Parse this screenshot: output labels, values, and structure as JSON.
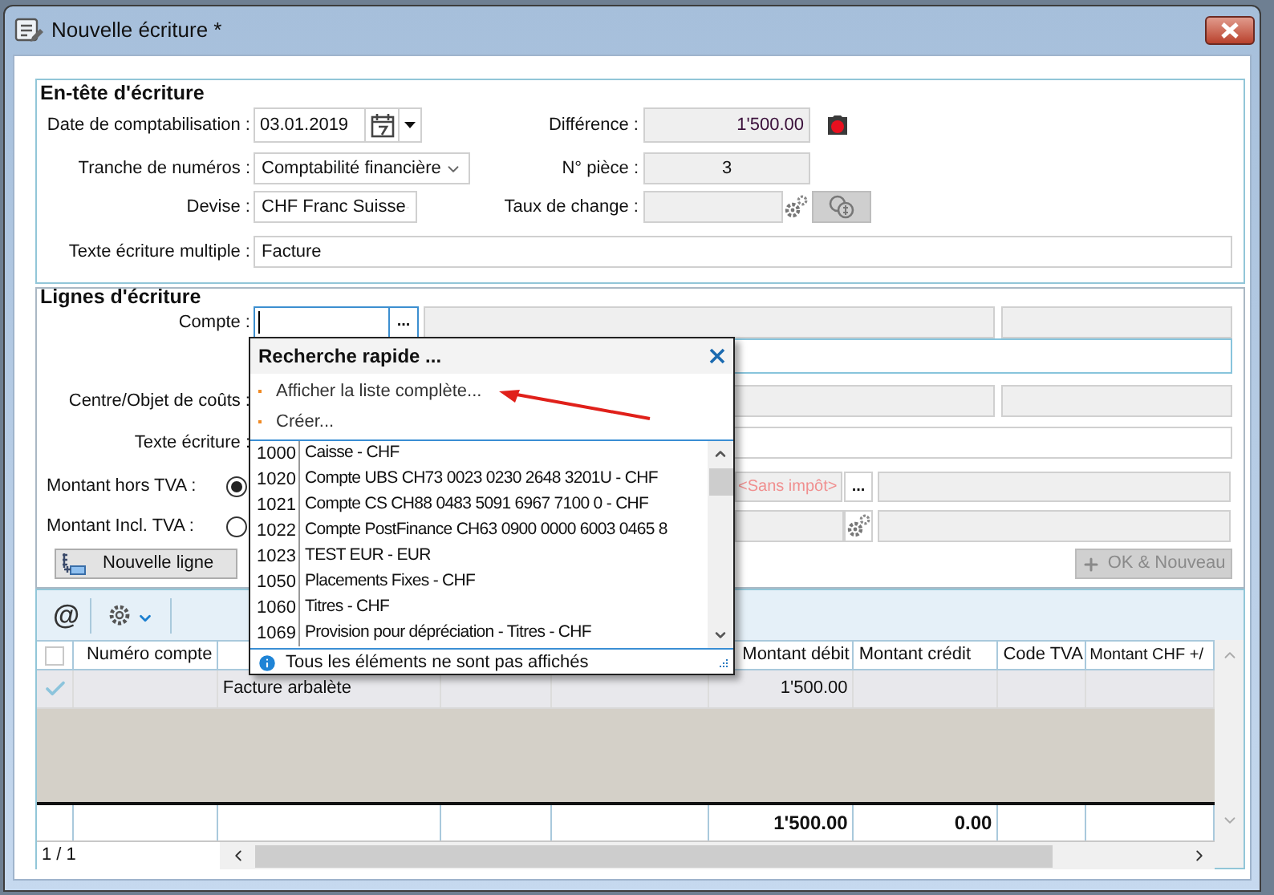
{
  "window": {
    "title": "Nouvelle écriture *"
  },
  "header_section": {
    "title": "En-tête d'écriture",
    "posting_date": {
      "label": "Date de comptabilisation :",
      "value": "03.01.2019"
    },
    "difference": {
      "label": "Différence :",
      "value": "1'500.00"
    },
    "number_range": {
      "label": "Tranche de numéros :",
      "value": "Comptabilité financière"
    },
    "document_number": {
      "label": "N° pièce :",
      "value": "3"
    },
    "currency": {
      "label": "Devise :",
      "value": "CHF Franc Suisse"
    },
    "exchange_rate": {
      "label": "Taux de change :"
    },
    "multi_entry_text": {
      "label": "Texte écriture multiple :",
      "value": "Facture"
    }
  },
  "lines_section": {
    "title": "Lignes d'écriture",
    "account": {
      "label": "Compte :",
      "button": "..."
    },
    "cost_center": {
      "label": "Centre/Objet de coûts :"
    },
    "entry_text": {
      "label": "Texte écriture :"
    },
    "amount_modes": [
      {
        "label": "Montant hors TVA :",
        "selected": true
      },
      {
        "label": "Montant Incl. TVA :",
        "selected": false
      }
    ],
    "tax_code": {
      "value": "<Sans impôt>",
      "button": "..."
    },
    "new_line_button": "Nouvelle ligne",
    "ok_new_button": {
      "label": "OK & Nouveau",
      "disabled": true
    }
  },
  "table": {
    "toolbar": {
      "at_button": "@"
    },
    "select_all_checked": false,
    "columns": [
      "Numéro compte",
      "Montant débit",
      "Montant crédit",
      "Code TVA",
      "Montant CHF +/"
    ],
    "rows": [
      {
        "checked": true,
        "text": "Facture arbalète",
        "debit": "1'500.00"
      }
    ],
    "totals": {
      "debit": "1'500.00",
      "credit": "0.00"
    },
    "pager": "1 / 1"
  },
  "quick_search": {
    "title": "Recherche rapide ...",
    "links": [
      "Afficher la liste complète...",
      "Créer..."
    ],
    "items": [
      {
        "code": "1000",
        "name": "Caisse - CHF"
      },
      {
        "code": "1020",
        "name": "Compte UBS CH73 0023 0230 2648 3201U - CHF"
      },
      {
        "code": "1021",
        "name": "Compte CS CH88 0483 5091 6967 7100 0 - CHF"
      },
      {
        "code": "1022",
        "name": "Compte PostFinance CH63 0900 0000 6003 0465 8"
      },
      {
        "code": "1023",
        "name": "TEST EUR - EUR"
      },
      {
        "code": "1050",
        "name": "Placements Fixes - CHF"
      },
      {
        "code": "1060",
        "name": "Titres - CHF"
      },
      {
        "code": "1069",
        "name": "Provision pour dépréciation - Titres - CHF"
      }
    ],
    "footer": "Tous les éléments ne sont pas affichés"
  }
}
